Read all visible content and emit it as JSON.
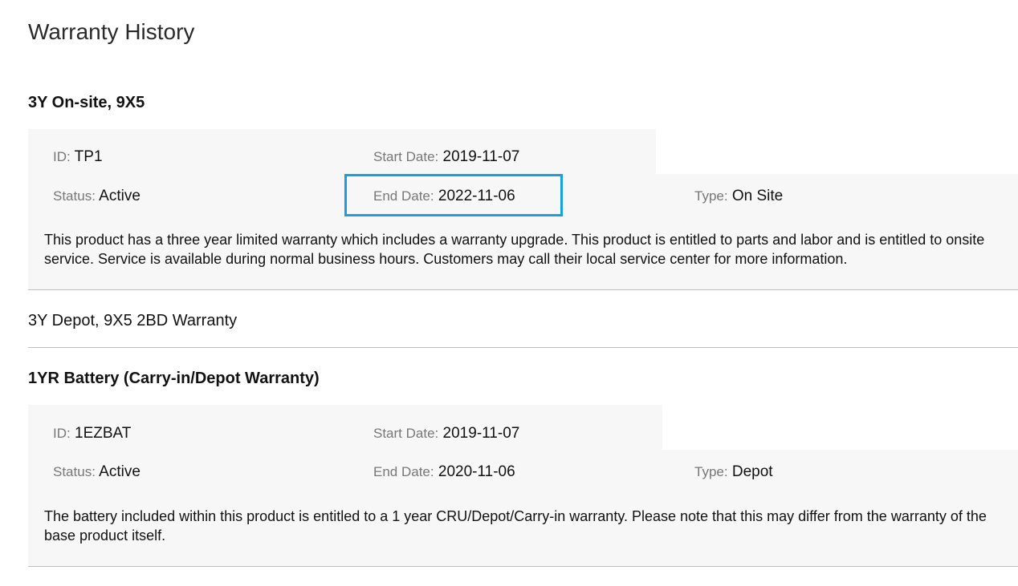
{
  "page_title": "Warranty History",
  "highlight_color": "#1a9fdc",
  "warranties": [
    {
      "title": "3Y On-site, 9X5",
      "id_label": "ID:",
      "id_value": "TP1",
      "start_label": "Start Date:",
      "start_value": "2019-11-07",
      "status_label": "Status:",
      "status_value": "Active",
      "end_label": "End Date:",
      "end_value": "2022-11-06",
      "type_label": "Type:",
      "type_value": "On Site",
      "description": "This product has a three year limited warranty which includes a warranty upgrade. This product is entitled to parts and labor and is entitled to onsite service. Service is available during normal business hours. Customers may call their local service center for more information."
    },
    {
      "title": "3Y Depot, 9X5 2BD Warranty"
    },
    {
      "title": "1YR Battery (Carry-in/Depot Warranty)",
      "id_label": "ID:",
      "id_value": "1EZBAT",
      "start_label": "Start Date:",
      "start_value": "2019-11-07",
      "status_label": "Status:",
      "status_value": "Active",
      "end_label": "End Date:",
      "end_value": "2020-11-06",
      "type_label": "Type:",
      "type_value": "Depot",
      "description": "The battery included within this product is entitled to a 1 year CRU/Depot/Carry-in warranty. Please note that this may differ from the warranty of the base product itself."
    }
  ]
}
